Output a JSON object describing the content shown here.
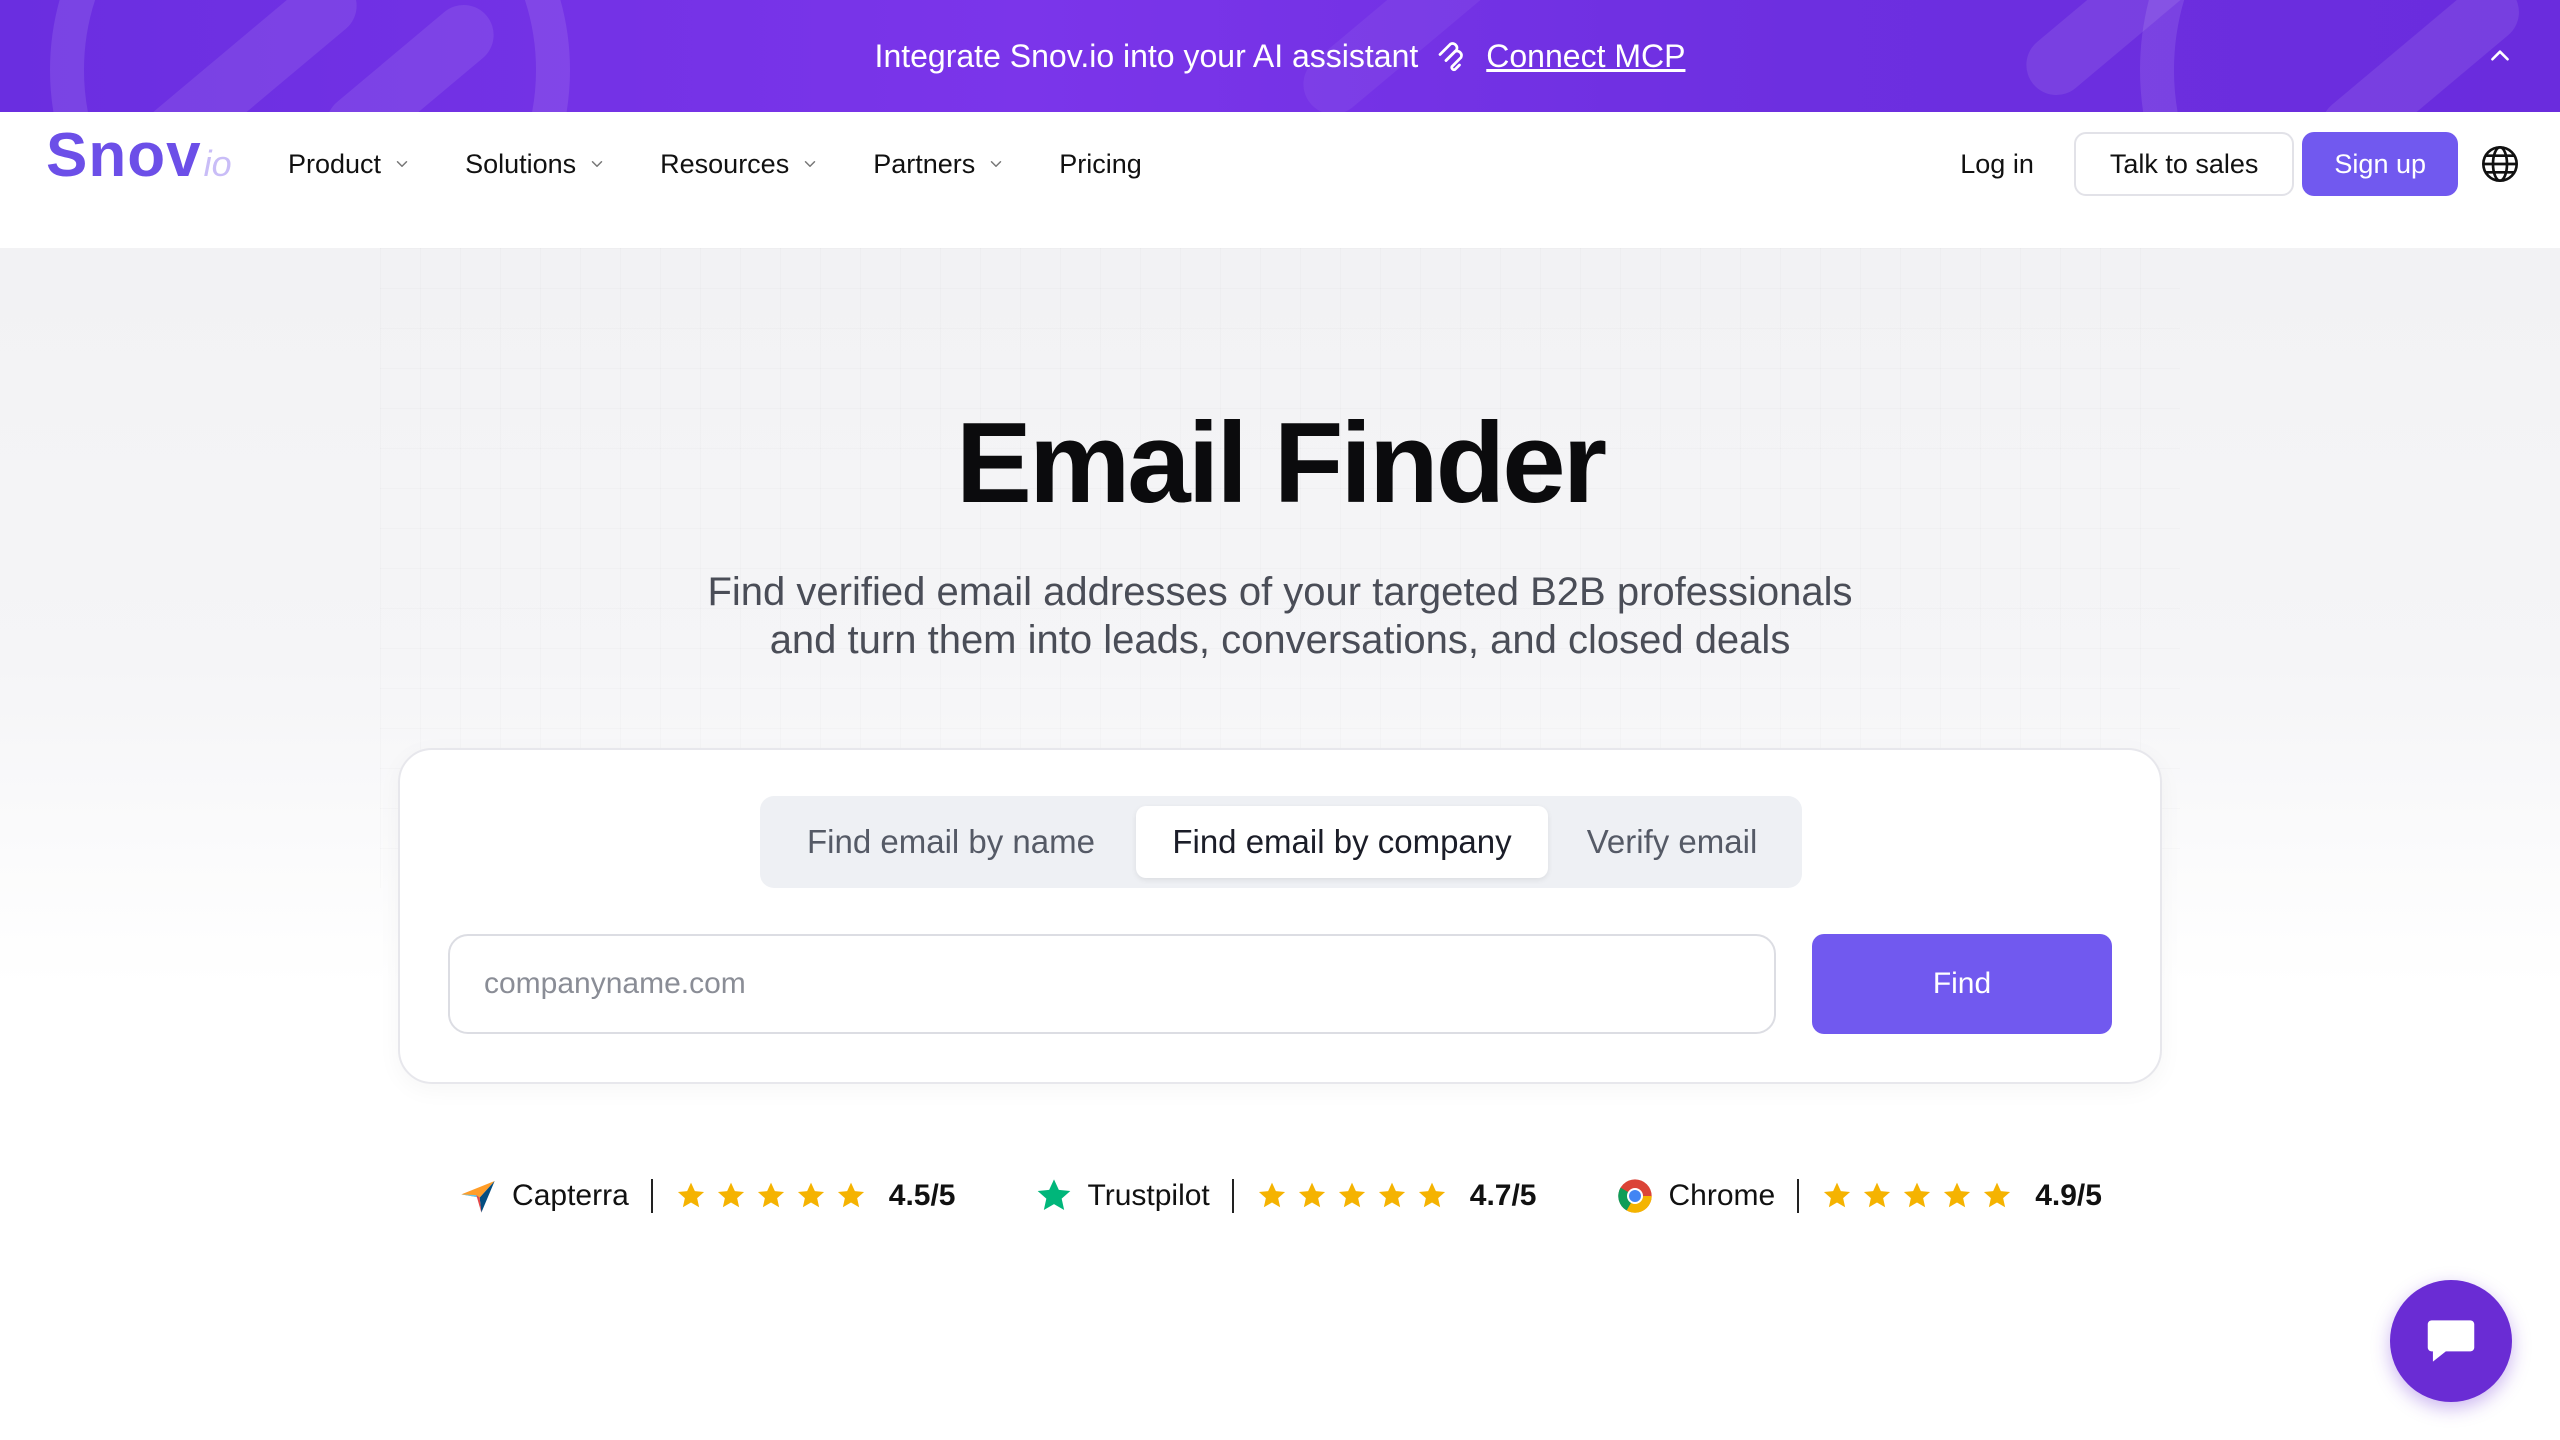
{
  "banner": {
    "text": "Integrate Snov.io into your AI assistant",
    "link_label": "Connect MCP"
  },
  "nav": {
    "logo_main": "Snov",
    "logo_suffix": "io",
    "items": [
      {
        "label": "Product",
        "has_dropdown": true
      },
      {
        "label": "Solutions",
        "has_dropdown": true
      },
      {
        "label": "Resources",
        "has_dropdown": true
      },
      {
        "label": "Partners",
        "has_dropdown": true
      },
      {
        "label": "Pricing",
        "has_dropdown": false
      }
    ],
    "login_label": "Log in",
    "talk_to_sales_label": "Talk to sales",
    "signup_label": "Sign up"
  },
  "hero": {
    "title": "Email Finder",
    "subtitle_line1": "Find verified email addresses of your targeted B2B professionals",
    "subtitle_line2": "and turn them into leads, conversations, and closed deals"
  },
  "search": {
    "tabs": [
      {
        "label": "Find email by name",
        "active": false
      },
      {
        "label": "Find email by company",
        "active": true
      },
      {
        "label": "Verify email",
        "active": false
      }
    ],
    "placeholder": "companyname.com",
    "value": "",
    "find_label": "Find"
  },
  "ratings": [
    {
      "source": "Capterra",
      "score": "4.5/5",
      "stars": 5
    },
    {
      "source": "Trustpilot",
      "score": "4.7/5",
      "stars": 5
    },
    {
      "source": "Chrome",
      "score": "4.9/5",
      "stars": 5
    }
  ],
  "colors": {
    "brand": "#7159ef",
    "banner": "#6a2ee0",
    "star": "#f5b301",
    "trustpilot": "#00b67a",
    "chat": "#6a2cd4"
  }
}
